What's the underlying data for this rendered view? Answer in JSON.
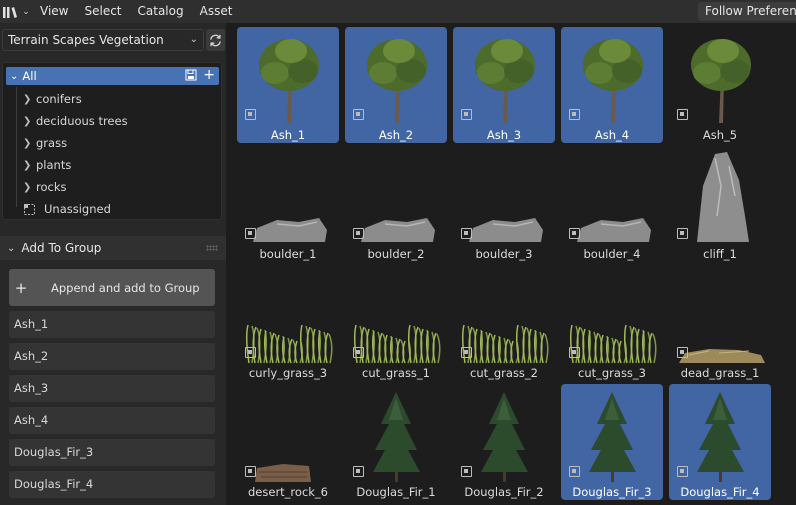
{
  "header": {
    "menus": [
      "View",
      "Select",
      "Catalog",
      "Asset"
    ],
    "follow_label": "Follow Preferences"
  },
  "library": {
    "selected": "Terrain Scapes Vegetation"
  },
  "catalogs": {
    "all": "All",
    "items": [
      "conifers",
      "deciduous trees",
      "grass",
      "plants",
      "rocks"
    ],
    "unassigned": "Unassigned"
  },
  "add_to_group": {
    "title": "Add To Group",
    "append_label": "Append and add to Group",
    "objects": [
      "Ash_1",
      "Ash_2",
      "Ash_3",
      "Ash_4",
      "Douglas_Fir_3",
      "Douglas_Fir_4"
    ]
  },
  "assets": [
    {
      "name": "Ash_1",
      "kind": "deciduous",
      "selected": true
    },
    {
      "name": "Ash_2",
      "kind": "deciduous",
      "selected": true
    },
    {
      "name": "Ash_3",
      "kind": "deciduous",
      "selected": true
    },
    {
      "name": "Ash_4",
      "kind": "deciduous",
      "selected": true
    },
    {
      "name": "Ash_5",
      "kind": "deciduous",
      "selected": false
    },
    {
      "name": "boulder_1",
      "kind": "rock",
      "selected": false
    },
    {
      "name": "boulder_2",
      "kind": "rock",
      "selected": false
    },
    {
      "name": "boulder_3",
      "kind": "rock",
      "selected": false
    },
    {
      "name": "boulder_4",
      "kind": "rock",
      "selected": false
    },
    {
      "name": "cliff_1",
      "kind": "cliff",
      "selected": false
    },
    {
      "name": "curly_grass_3",
      "kind": "grass",
      "selected": false
    },
    {
      "name": "cut_grass_1",
      "kind": "grass",
      "selected": false
    },
    {
      "name": "cut_grass_2",
      "kind": "grass",
      "selected": false
    },
    {
      "name": "cut_grass_3",
      "kind": "grass",
      "selected": false
    },
    {
      "name": "dead_grass_1",
      "kind": "deadgrass",
      "selected": false
    },
    {
      "name": "desert_rock_6",
      "kind": "desertrock",
      "selected": false
    },
    {
      "name": "Douglas_Fir_1",
      "kind": "conifer",
      "selected": false
    },
    {
      "name": "Douglas_Fir_2",
      "kind": "conifer",
      "selected": false
    },
    {
      "name": "Douglas_Fir_3",
      "kind": "conifer",
      "selected": true
    },
    {
      "name": "Douglas_Fir_4",
      "kind": "conifer",
      "selected": true
    }
  ],
  "colors": {
    "accent": "#4772b3",
    "selected_tile": "#4166a3",
    "background": "#1d1d1d",
    "panel": "#282828"
  }
}
